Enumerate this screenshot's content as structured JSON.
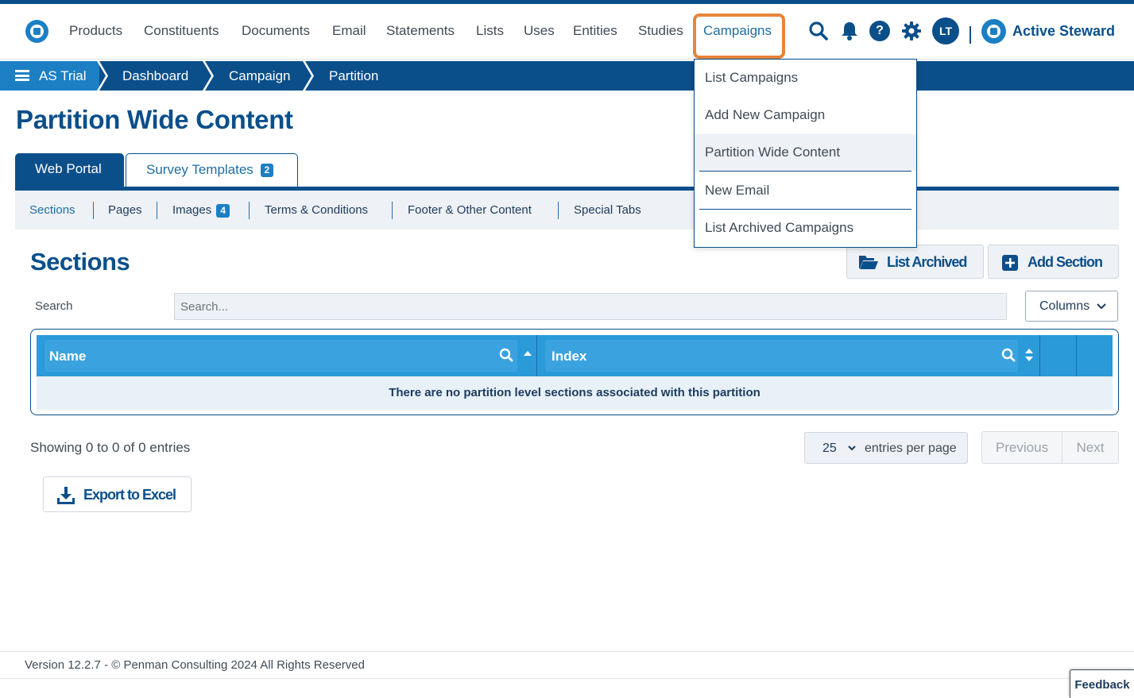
{
  "nav": {
    "items": [
      "Products",
      "Constituents",
      "Documents",
      "Email",
      "Statements",
      "Lists",
      "Uses",
      "Entities",
      "Studies",
      "Campaigns"
    ],
    "active": "Campaigns",
    "avatar_initials": "LT",
    "brand": "Active Steward",
    "icons": [
      "search-icon",
      "bell-icon",
      "help-icon",
      "gear-icon"
    ]
  },
  "breadcrumb": {
    "items": [
      "AS Trial",
      "Dashboard",
      "Campaign",
      "Partition"
    ]
  },
  "page": {
    "title": "Partition Wide Content"
  },
  "tabs": [
    {
      "label": "Web Portal",
      "active": true
    },
    {
      "label": "Survey Templates",
      "badge": "2",
      "active": false
    }
  ],
  "subnav": {
    "items": [
      {
        "label": "Sections",
        "active": true
      },
      {
        "label": "Pages"
      },
      {
        "label": "Images",
        "badge": "4"
      },
      {
        "label": "Terms & Conditions"
      },
      {
        "label": "Footer & Other Content"
      },
      {
        "label": "Special Tabs"
      }
    ]
  },
  "sections": {
    "title": "Sections",
    "list_archived_label": "List Archived",
    "add_section_label": "Add Section",
    "search_label": "Search",
    "search_placeholder": "Search...",
    "columns_label": "Columns",
    "table": {
      "headers": [
        "Name",
        "Index"
      ],
      "empty_message": "There are no partition level sections associated with this partition"
    },
    "showing": "Showing 0 to 0 of 0 entries",
    "per_page_value": "25",
    "per_page_label": "entries per page",
    "previous_label": "Previous",
    "next_label": "Next",
    "export_label": "Export to Excel"
  },
  "dropdown": {
    "items": [
      "List Campaigns",
      "Add New Campaign",
      "Partition Wide Content",
      "New Email",
      "List Archived Campaigns"
    ],
    "active": "Partition Wide Content"
  },
  "footer": {
    "text": "Version 12.2.7 - © Penman Consulting 2024 All Rights Reserved",
    "feedback_label": "Feedback"
  },
  "colors": {
    "primary": "#0b4f8a",
    "accent": "#1c7fc4",
    "table_header": "#2b9ad9",
    "highlight": "#e8853a"
  }
}
